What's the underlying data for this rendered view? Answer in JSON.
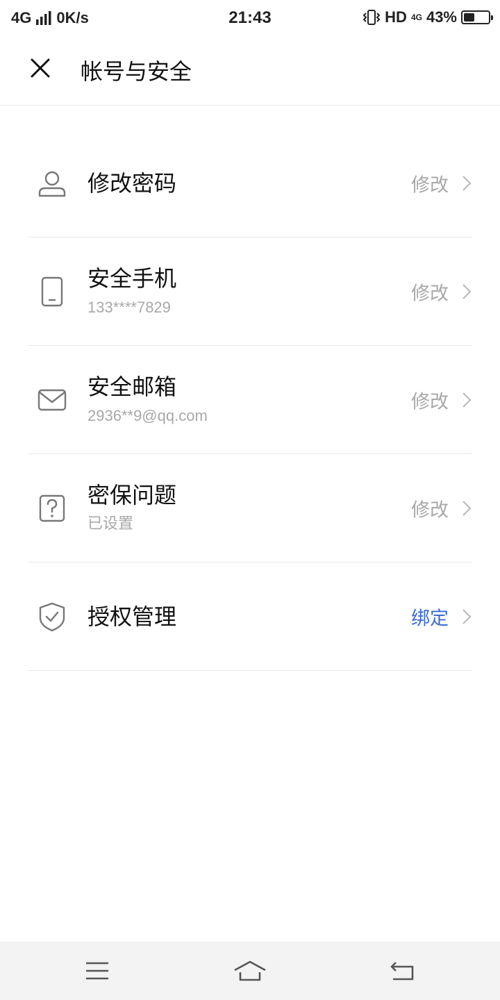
{
  "status_bar": {
    "network": "4G",
    "speed": "0K/s",
    "time": "21:43",
    "hd": "HD",
    "network_small": "4G",
    "battery_percent": "43%",
    "battery_level": 0.43,
    "icons": [
      "signal-bars-icon",
      "vibrate-icon",
      "battery-icon"
    ]
  },
  "header": {
    "title": "帐号与安全",
    "close_icon": "close-icon"
  },
  "items": [
    {
      "icon": "user-icon",
      "title": "修改密码",
      "subtitle": "",
      "action": "修改"
    },
    {
      "icon": "phone-icon",
      "title": "安全手机",
      "subtitle": "133****7829",
      "action": "修改"
    },
    {
      "icon": "mail-icon",
      "title": "安全邮箱",
      "subtitle": "2936**9@qq.com",
      "action": "修改"
    },
    {
      "icon": "question-icon",
      "title": "密保问题",
      "subtitle": "已设置",
      "action": "修改"
    },
    {
      "icon": "shield-check-icon",
      "title": "授权管理",
      "subtitle": "",
      "action": "绑定"
    }
  ],
  "colors": {
    "accent": "#3a6ad3",
    "muted_text": "#a8a8a8",
    "divider": "#e6e6e6",
    "nav_bg": "#f3f3f3"
  },
  "nav_bar": {
    "icons": [
      "menu-icon",
      "home-icon",
      "back-icon"
    ]
  }
}
